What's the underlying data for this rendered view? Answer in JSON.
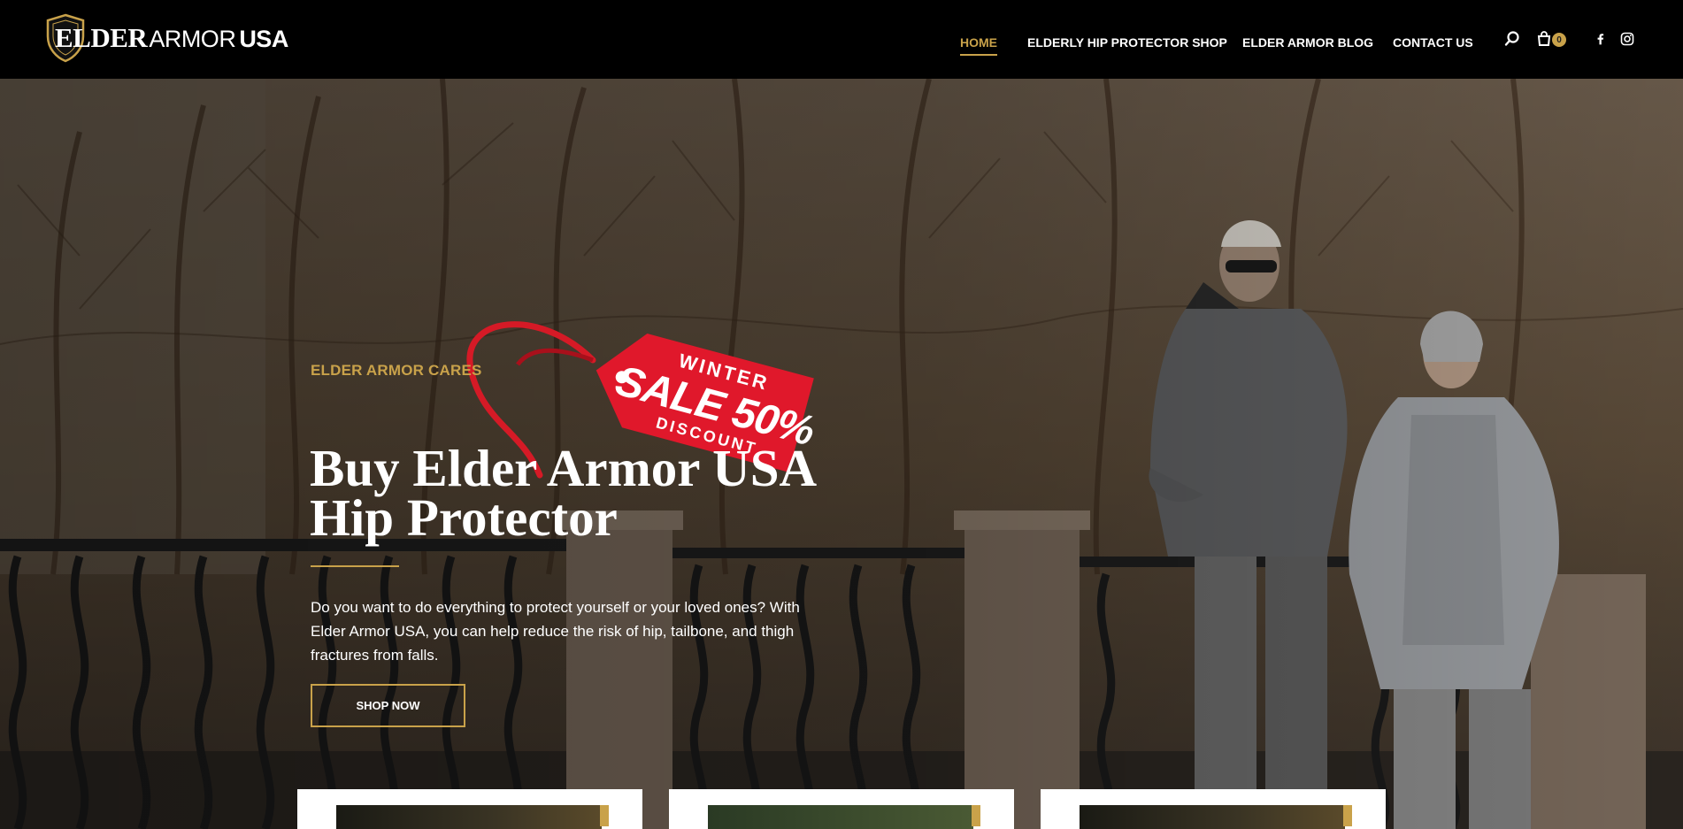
{
  "header": {
    "logo": {
      "elder": "ELDER",
      "armor": "ARMOR",
      "usa": "USA"
    },
    "nav": [
      {
        "label": "HOME",
        "active": true
      },
      {
        "label": "ELDERLY HIP PROTECTOR SHOP",
        "active": false
      },
      {
        "label": "ELDER ARMOR BLOG",
        "active": false
      },
      {
        "label": "CONTACT US",
        "active": false
      }
    ],
    "cart_count": "0",
    "icons": [
      "search-icon",
      "cart-icon",
      "facebook-icon",
      "instagram-icon"
    ]
  },
  "hero": {
    "tag": {
      "line1": "WINTER",
      "line2": "SALE 50%",
      "line3": "DISCOUNT"
    },
    "eyebrow": "ELDER ARMOR CARES",
    "title_line1": "Buy Elder Armor USA",
    "title_line2": "Hip Protector",
    "description": "Do you want to do everything to protect yourself or your loved ones? With Elder Armor USA, you can help reduce the risk of hip, tailbone, and thigh fractures from falls.",
    "cta": "SHOP NOW"
  },
  "colors": {
    "accent": "#c9a24a",
    "header_bg": "#000000",
    "tag_red": "#e0182b"
  }
}
